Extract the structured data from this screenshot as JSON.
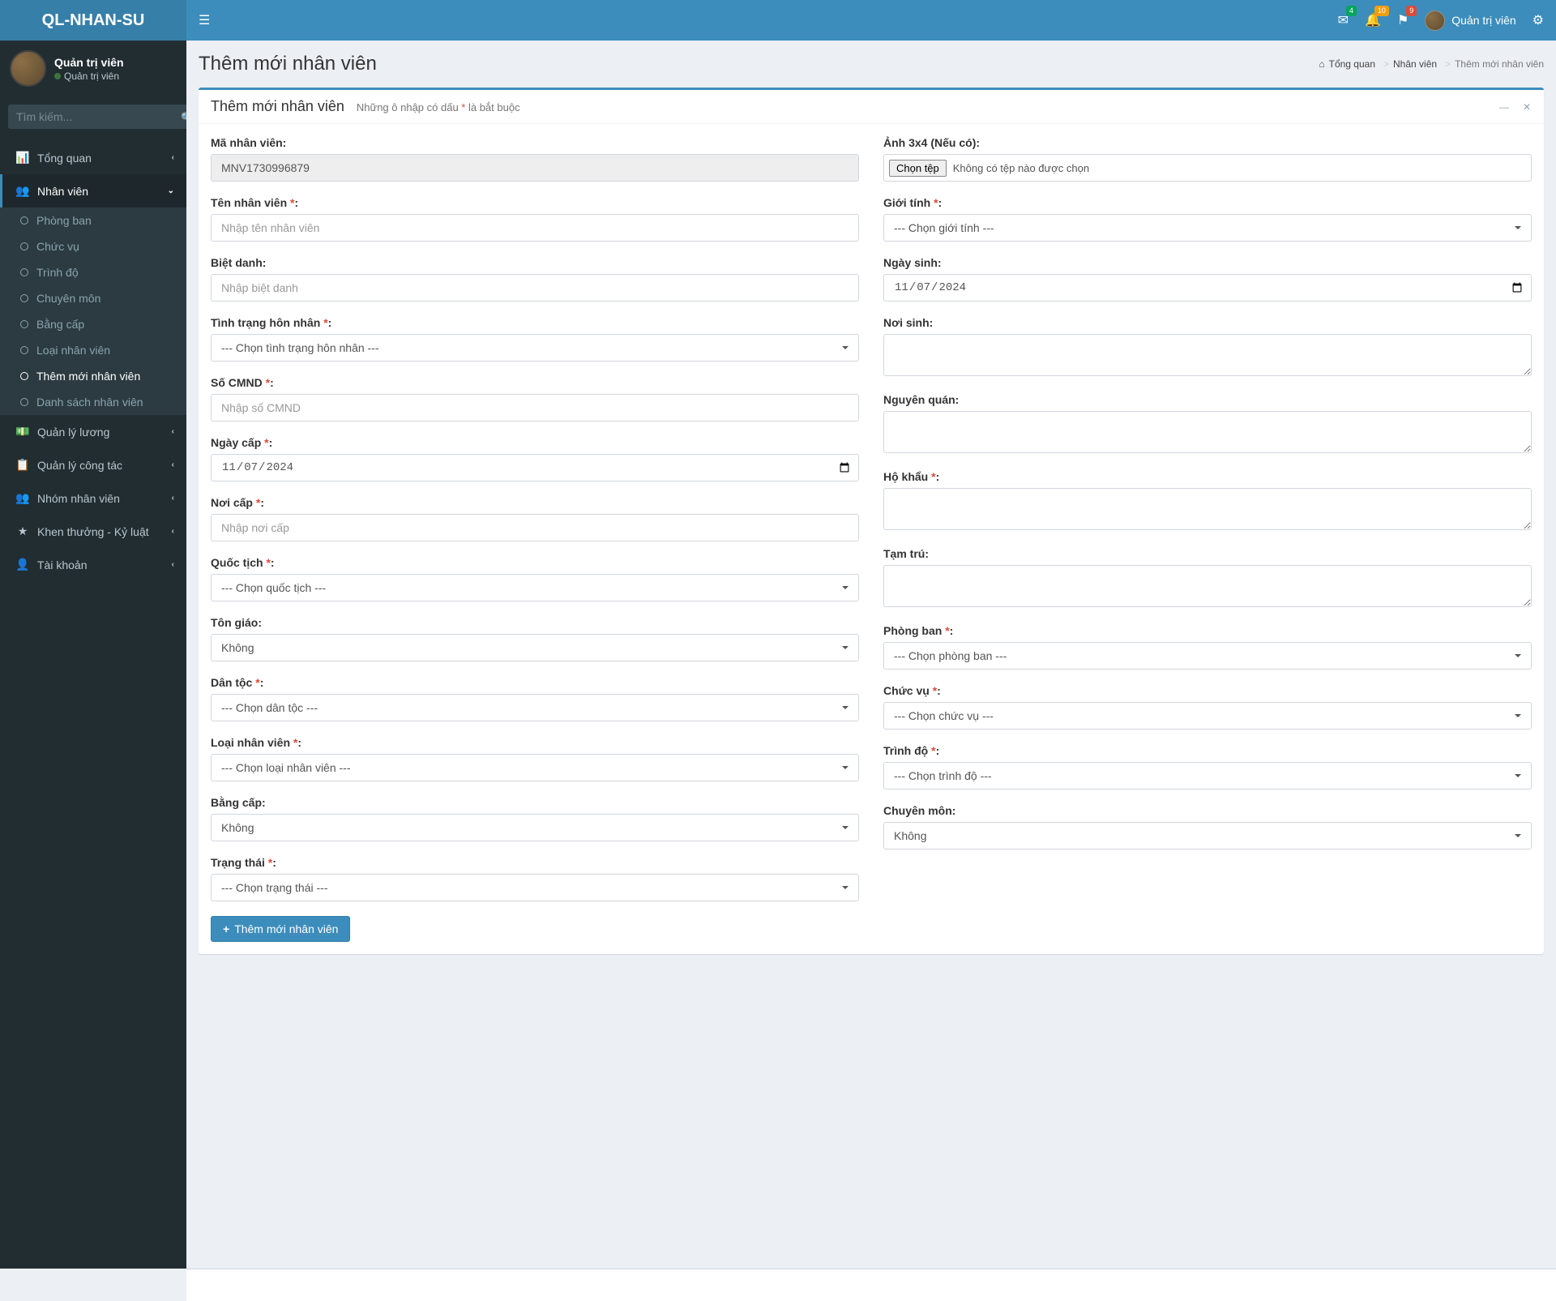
{
  "header": {
    "logo": "QL-NHAN-SU",
    "badges": {
      "mail": "4",
      "bell": "10",
      "flag": "9"
    },
    "username": "Quản trị viên"
  },
  "sidebar": {
    "user": {
      "name": "Quản trị viên",
      "role": "Quản trị viên"
    },
    "search_placeholder": "Tìm kiếm...",
    "menu": [
      {
        "label": "Tổng quan"
      },
      {
        "label": "Nhân viên"
      },
      {
        "label": "Quản lý lương"
      },
      {
        "label": "Quản lý công tác"
      },
      {
        "label": "Nhóm nhân viên"
      },
      {
        "label": "Khen thưởng - Kỷ luật"
      },
      {
        "label": "Tài khoản"
      }
    ],
    "submenu": [
      {
        "label": "Phòng ban"
      },
      {
        "label": "Chức vụ"
      },
      {
        "label": "Trình độ"
      },
      {
        "label": "Chuyên môn"
      },
      {
        "label": "Bằng cấp"
      },
      {
        "label": "Loại nhân viên"
      },
      {
        "label": "Thêm mới nhân viên"
      },
      {
        "label": "Danh sách nhân viên"
      }
    ]
  },
  "page": {
    "title": "Thêm mới nhân viên",
    "breadcrumb": [
      {
        "text": "Tổng quan"
      },
      {
        "text": "Nhân viên"
      },
      {
        "text": "Thêm mới nhân viên"
      }
    ],
    "box_title": "Thêm mới nhân viên",
    "box_subtitle_pre": "Những ô nhập có dấu ",
    "box_subtitle_post": " là bắt buộc",
    "box_subtitle_star": "*"
  },
  "form": {
    "left": {
      "ma_nv": {
        "label": "Mã nhân viên:",
        "value": "MNV1730996879"
      },
      "ten_nv": {
        "label": "Tên nhân viên ",
        "placeholder": "Nhập tên nhân viên"
      },
      "biet_danh": {
        "label": "Biệt danh:",
        "placeholder": "Nhập biệt danh"
      },
      "hon_nhan": {
        "label": "Tình trạng hôn nhân ",
        "selected": "--- Chọn tình trạng hôn nhân ---"
      },
      "cmnd": {
        "label": "Số CMND ",
        "placeholder": "Nhập số CMND"
      },
      "ngay_cap": {
        "label": "Ngày cấp ",
        "value": "07/11/2024",
        "raw": "2024-11-07"
      },
      "noi_cap": {
        "label": "Nơi cấp ",
        "placeholder": "Nhập nơi cấp"
      },
      "quoc_tich": {
        "label": "Quốc tịch ",
        "selected": "--- Chọn quốc tịch ---"
      },
      "ton_giao": {
        "label": "Tôn giáo:",
        "selected": "Không"
      },
      "dan_toc": {
        "label": "Dân tộc ",
        "selected": "--- Chọn dân tộc ---"
      },
      "loai_nv": {
        "label": "Loại nhân viên ",
        "selected": "--- Chọn loại nhân viên ---"
      },
      "bang_cap": {
        "label": "Bằng cấp:",
        "selected": "Không"
      },
      "trang_thai": {
        "label": "Trạng thái ",
        "selected": "--- Chọn trạng thái ---"
      }
    },
    "right": {
      "anh": {
        "label": "Ảnh 3x4 (Nếu có):",
        "btn": "Chọn tệp",
        "no_file": "Không có tệp nào được chọn"
      },
      "gioi_tinh": {
        "label": "Giới tính ",
        "selected": "--- Chọn giới tính ---"
      },
      "ngay_sinh": {
        "label": "Ngày sinh:",
        "value": "07/11/2024",
        "raw": "2024-11-07"
      },
      "noi_sinh": {
        "label": "Nơi sinh:"
      },
      "nguyen_quan": {
        "label": "Nguyên quán:"
      },
      "ho_khau": {
        "label": "Hộ khẩu "
      },
      "tam_tru": {
        "label": "Tạm trú:"
      },
      "phong_ban": {
        "label": "Phòng ban ",
        "selected": "--- Chọn phòng ban ---"
      },
      "chuc_vu": {
        "label": "Chức vụ ",
        "selected": "--- Chọn chức vụ ---"
      },
      "trinh_do": {
        "label": "Trình độ ",
        "selected": "--- Chọn trình độ ---"
      },
      "chuyen_mon": {
        "label": "Chuyên môn:",
        "selected": "Không"
      }
    },
    "submit": "Thêm mới nhân viên",
    "colon": ":"
  }
}
